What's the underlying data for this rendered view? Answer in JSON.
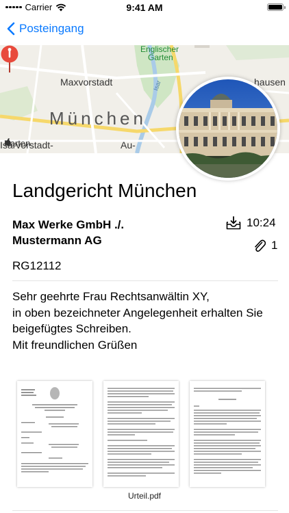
{
  "status_bar": {
    "carrier": "Carrier",
    "time": "9:41 AM"
  },
  "nav": {
    "back_label": "Posteingang"
  },
  "map": {
    "city": "München",
    "labels": {
      "maxvorstadt": "Maxvorstadt",
      "englischer": "Englischer",
      "garten": "Garten",
      "hausen": "hausen",
      "isarvorstadt": "Isarvorstadt-",
      "karten": "Karten",
      "au": "Au-",
      "isar": "Isar"
    }
  },
  "letter": {
    "title": "Landgericht München",
    "parties_line1": "Max Werke GmbH ./.",
    "parties_line2": "Mustermann AG",
    "time": "10:24",
    "attachments": "1",
    "reference": "RG12112",
    "message": "Sehr geehrte Frau Rechtsanwältin XY,\nin oben bezeichneter Angelegenheit erhalten Sie beigefügtes Schreiben.\nMit freundlichen Grüßen"
  },
  "attachment": {
    "file_name": "Urteil.pdf"
  },
  "colors": {
    "accent": "#0a7aff",
    "pin": "#e84a3c",
    "map_bg": "#f1efe9"
  }
}
